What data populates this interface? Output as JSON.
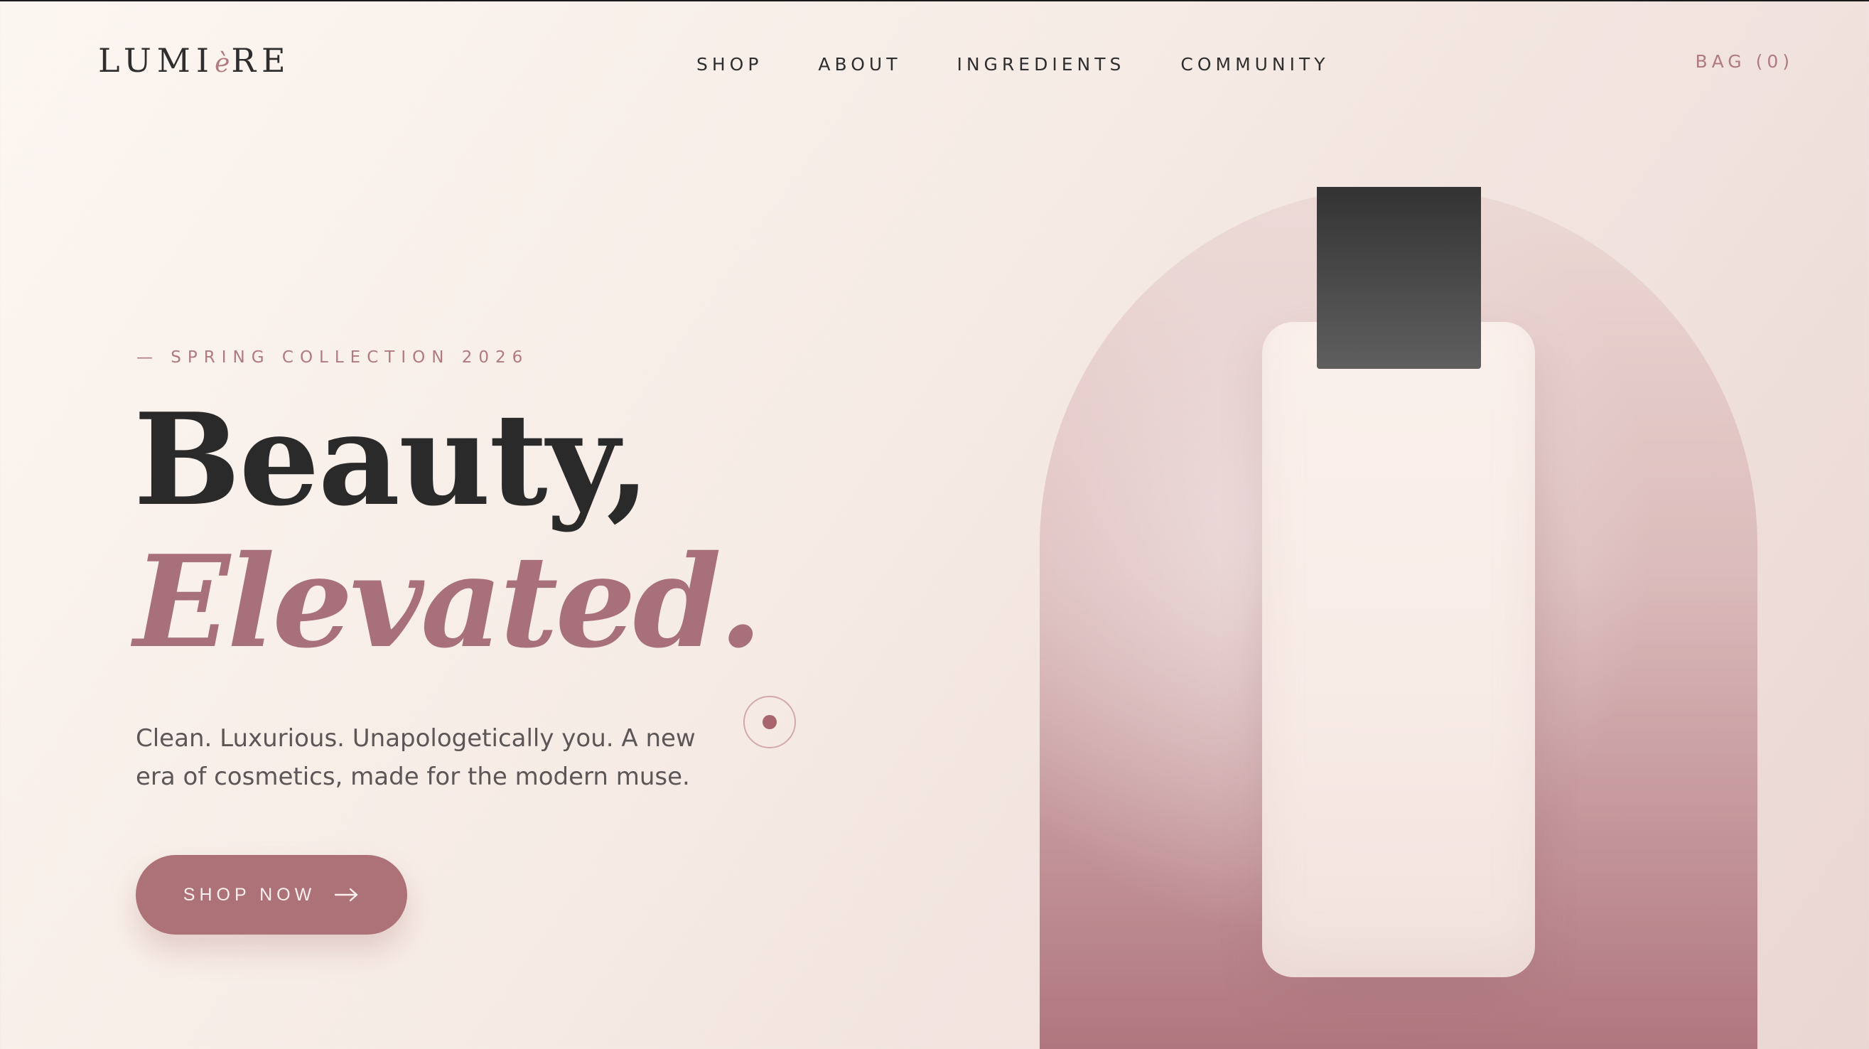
{
  "brand": {
    "logo_pre": "LUMI",
    "logo_accent": "è",
    "logo_post": "RE"
  },
  "nav": {
    "items": [
      "SHOP",
      "ABOUT",
      "INGREDIENTS",
      "COMMUNITY"
    ]
  },
  "bag": {
    "label": "BAG (0)"
  },
  "hero": {
    "eyebrow": "— SPRING COLLECTION 2026",
    "title_line1": "Beauty,",
    "title_line2": "Elevated.",
    "subtitle": "Clean. Luxurious. Unapologetically you. A new era of cosmetics, made for the modern muse.",
    "cta_label": "SHOP NOW",
    "cta_icon": "arrow-right-icon"
  },
  "colors": {
    "accent": "#ad7278",
    "text": "#2a2a2a",
    "background": "#f6ebe5",
    "cap": "#3a3a3a"
  }
}
